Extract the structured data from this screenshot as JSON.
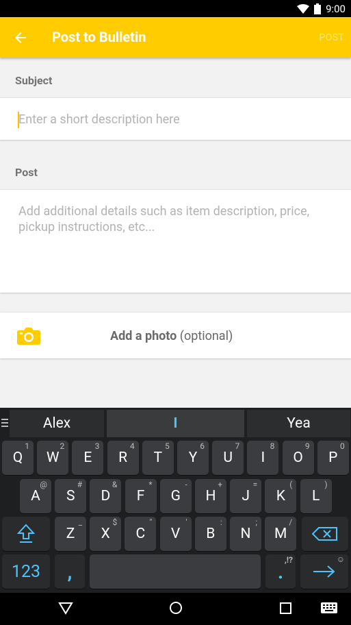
{
  "status_bar": {
    "time": "9:00"
  },
  "app_bar": {
    "title": "Post to Bulletin",
    "action": "POST"
  },
  "subject": {
    "label": "Subject",
    "placeholder": "Enter a short description here"
  },
  "post": {
    "label": "Post",
    "placeholder": "Add additional details such as item description, price, pickup instructions, etc..."
  },
  "photo": {
    "label": "Add a photo",
    "optional": "(optional)"
  },
  "keyboard": {
    "suggestions": [
      "Alex",
      "I",
      "Yea"
    ],
    "row1": [
      {
        "k": "Q",
        "s": "1"
      },
      {
        "k": "W",
        "s": "2"
      },
      {
        "k": "E",
        "s": "3"
      },
      {
        "k": "R",
        "s": "4"
      },
      {
        "k": "T",
        "s": "5"
      },
      {
        "k": "Y",
        "s": "6"
      },
      {
        "k": "U",
        "s": "7"
      },
      {
        "k": "I",
        "s": "8"
      },
      {
        "k": "O",
        "s": "9"
      },
      {
        "k": "P",
        "s": "0"
      }
    ],
    "row2": [
      {
        "k": "A",
        "s": "@"
      },
      {
        "k": "S",
        "s": "#"
      },
      {
        "k": "D",
        "s": "&"
      },
      {
        "k": "F",
        "s": "*"
      },
      {
        "k": "G",
        "s": "-"
      },
      {
        "k": "H",
        "s": "+"
      },
      {
        "k": "J",
        "s": "="
      },
      {
        "k": "K",
        "s": "("
      },
      {
        "k": "L",
        "s": ")"
      }
    ],
    "row3": [
      {
        "k": "Z",
        "s": "_"
      },
      {
        "k": "X",
        "s": "$"
      },
      {
        "k": "C",
        "s": "\""
      },
      {
        "k": "V",
        "s": "'"
      },
      {
        "k": "B",
        "s": ":"
      },
      {
        "k": "N",
        "s": ";"
      },
      {
        "k": "M",
        "s": "/"
      }
    ],
    "numbers_label": "123",
    "comma": ",",
    "period": ".",
    "period_alt": ",!?"
  },
  "colors": {
    "accent": "#ffcc00",
    "keyboard_accent": "#4fc3f7"
  }
}
